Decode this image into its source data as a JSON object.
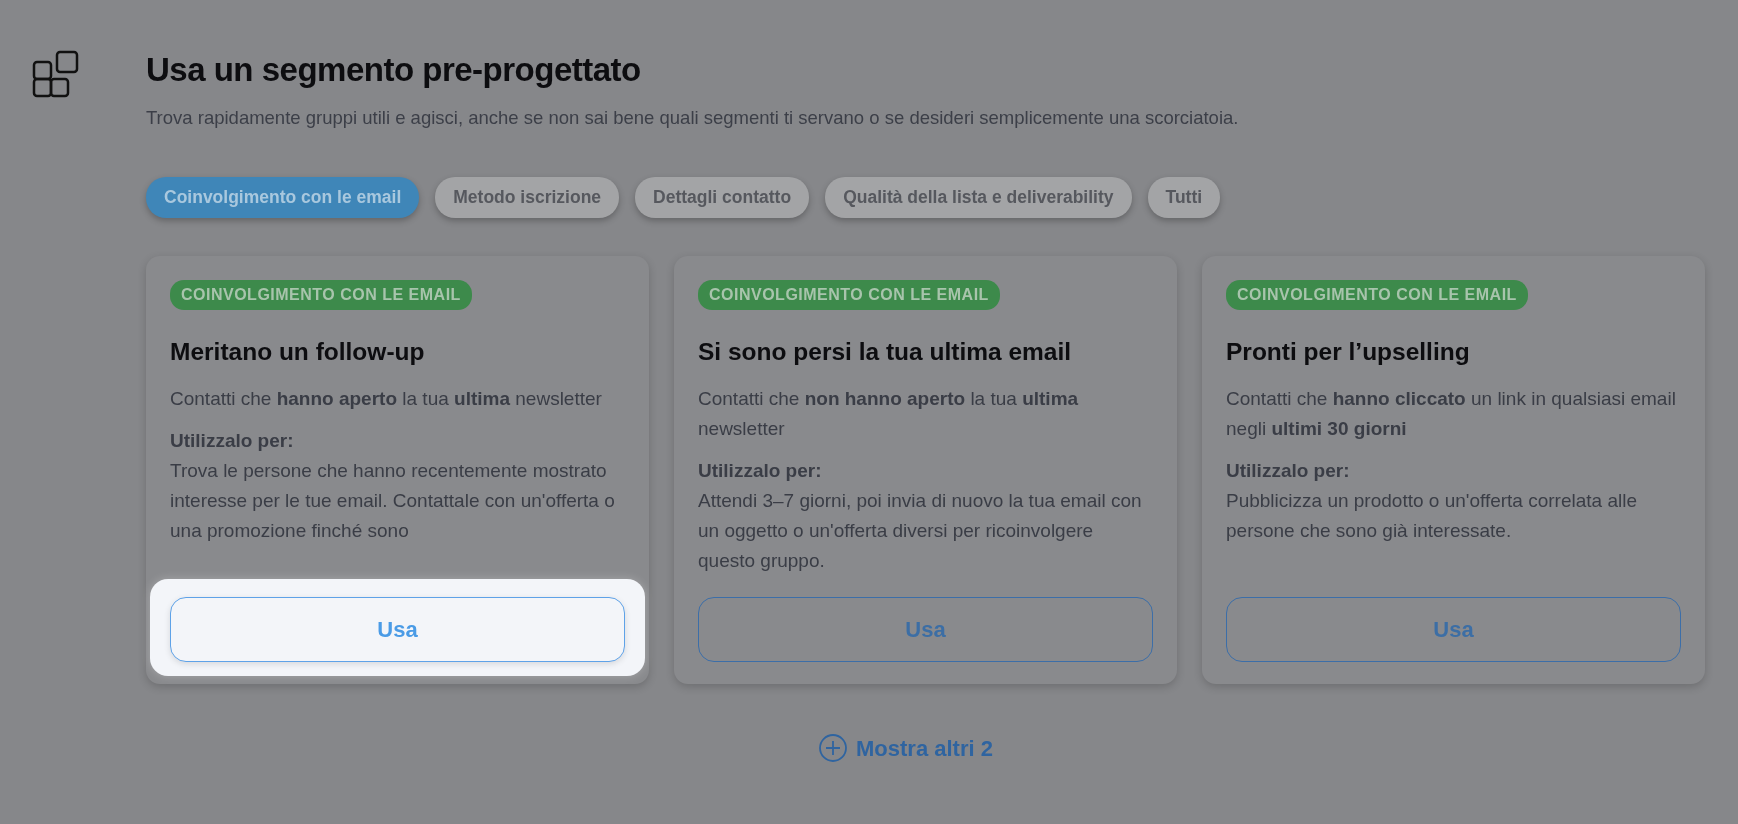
{
  "header": {
    "title": "Usa un segmento pre-progettato",
    "subtitle": "Trova rapidamente gruppi utili e agisci, anche se non sai bene quali segmenti ti servano o se desideri semplicemente una scorciatoia."
  },
  "filters": [
    {
      "label": "Coinvolgimento con le email",
      "selected": true
    },
    {
      "label": "Metodo iscrizione",
      "selected": false
    },
    {
      "label": "Dettagli contatto",
      "selected": false
    },
    {
      "label": "Qualità della lista e deliverability",
      "selected": false
    },
    {
      "label": "Tutti",
      "selected": false
    }
  ],
  "cards": [
    {
      "tag": "COINVOLGIMENTO CON LE EMAIL",
      "title": "Meritano un follow-up",
      "summary": "Contatti che **hanno aperto** la tua **ultima** newsletter",
      "use_label": "Utilizzalo per:",
      "use_text": "Trova le persone che hanno recentemente mostrato interesse per le tue email. Contattale con un'offerta o una promozione finché sono",
      "button": "Usa",
      "highlighted": true
    },
    {
      "tag": "COINVOLGIMENTO CON LE EMAIL",
      "title": "Si sono persi la tua ultima email",
      "summary": "Contatti che **non hanno aperto** la tua **ultima** newsletter",
      "use_label": "Utilizzalo per:",
      "use_text": "Attendi 3–7 giorni, poi invia di nuovo la tua email con un oggetto o un'offerta diversi per ricoinvolgere questo gruppo.",
      "button": "Usa",
      "highlighted": false
    },
    {
      "tag": "COINVOLGIMENTO CON LE EMAIL",
      "title": "Pronti per l’upselling",
      "summary": "Contatti che **hanno cliccato** un link in qualsiasi email negli **ultimi 30 giorni**",
      "use_label": "Utilizzalo per:",
      "use_text": "Pubblicizza un prodotto o un'offerta correlata alle persone che sono già interessate.",
      "button": "Usa",
      "highlighted": false
    }
  ],
  "show_more": "Mostra altri 2"
}
